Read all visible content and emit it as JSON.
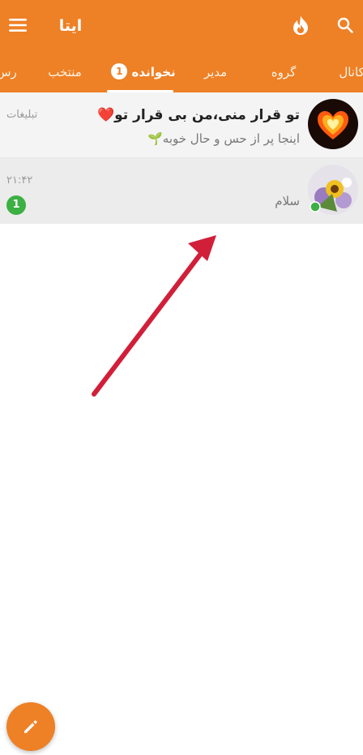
{
  "app": {
    "title": "ایتا",
    "accent": "#ee8026"
  },
  "toolbar": {
    "menu_icon": "hamburger-icon",
    "brand_icon": "flame-icon",
    "search_icon": "search-icon"
  },
  "tabs": {
    "items": [
      {
        "label": "کانال"
      },
      {
        "label": "گروه"
      },
      {
        "label": "مدیر"
      },
      {
        "label": "نخوانده",
        "badge": "1",
        "active": true
      },
      {
        "label": "منتخب"
      },
      {
        "label": "رس"
      }
    ]
  },
  "chats": [
    {
      "title": "تو قرار منی،من بی قرار تو❤️",
      "preview": "اینجا پر از حس و حال خوبه🌱",
      "meta": "تبلیغات"
    },
    {
      "title": "",
      "preview": "سلام",
      "time": "۲۱:۴۲",
      "unread": "1",
      "online": true
    }
  ],
  "fab": {
    "icon": "pencil-icon"
  },
  "annotation": {
    "type": "arrow",
    "color": "#d11f3a"
  }
}
